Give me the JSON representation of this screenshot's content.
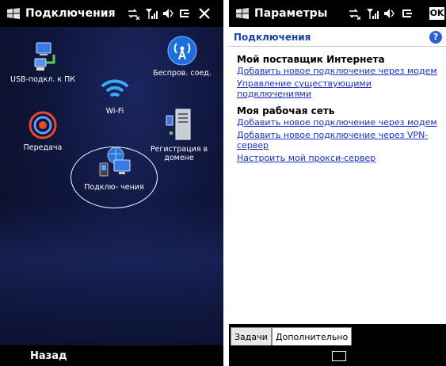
{
  "left_screen": {
    "title": "Подключения",
    "tiles": [
      {
        "label": "USB-подкл. к ПК",
        "icon": "usb-pc-icon"
      },
      {
        "label": "Беспров. соед.",
        "icon": "wireless-icon"
      },
      {
        "label": "Wi-Fi",
        "icon": "wifi-icon"
      },
      {
        "label": "Передача",
        "icon": "beam-icon"
      },
      {
        "label": "Регистрация в",
        "label2": "домене",
        "icon": "server-icon"
      },
      {
        "label": "Подклю- чения",
        "icon": "connections-icon"
      }
    ],
    "back_label": "Назад"
  },
  "right_screen": {
    "title": "Параметры",
    "ok_label": "OK",
    "header": "Подключения",
    "help_label": "?",
    "sections": [
      {
        "title": "Мой поставщик Интернета",
        "links": [
          {
            "lines": [
              "Добавить новое подключение через модем"
            ]
          },
          {
            "lines": [
              "Управление существующими",
              "подключениями"
            ]
          }
        ]
      },
      {
        "title": "Моя рабочая сеть",
        "links": [
          {
            "lines": [
              "Добавить новое подключение через модем"
            ]
          },
          {
            "lines": [
              "Добавить новое подключение через VPN-",
              "сервер"
            ]
          },
          {
            "lines": [
              "Настроить мой прокси-сервер"
            ]
          }
        ]
      }
    ],
    "tabs": [
      "Задачи",
      "Дополнительно"
    ]
  },
  "colors": {
    "link": "#1a2fd8",
    "header": "#1a3fb0",
    "accent": "#2a5ed8"
  }
}
